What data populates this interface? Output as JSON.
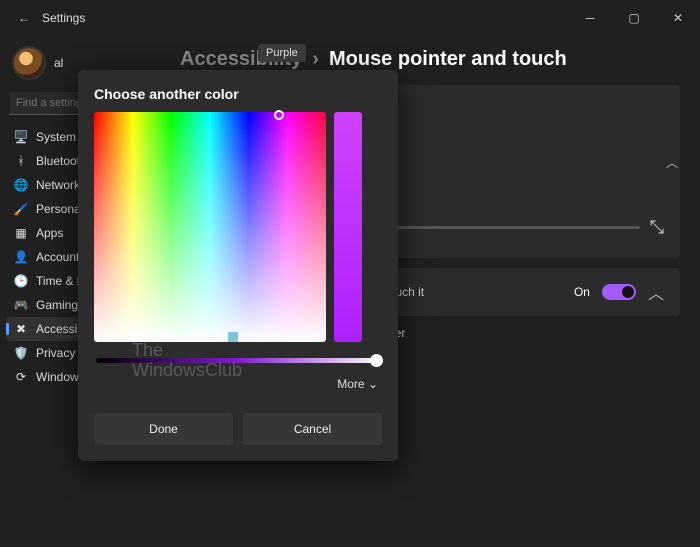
{
  "title": "Settings",
  "account_name": "al",
  "search_placeholder": "Find a setting",
  "sidebar": {
    "items": [
      {
        "icon": "🖥️",
        "label": "System"
      },
      {
        "icon": "ᚼ",
        "label": "Bluetooth & devices"
      },
      {
        "icon": "🌐",
        "label": "Network & internet"
      },
      {
        "icon": "🖌️",
        "label": "Personalization"
      },
      {
        "icon": "▦",
        "label": "Apps"
      },
      {
        "icon": "👤",
        "label": "Accounts"
      },
      {
        "icon": "🕒",
        "label": "Time & language"
      },
      {
        "icon": "🎮",
        "label": "Gaming"
      },
      {
        "icon": "✖",
        "label": "Accessibility",
        "selected": true
      },
      {
        "icon": "🛡️",
        "label": "Privacy & security"
      },
      {
        "icon": "⟳",
        "label": "Windows Update"
      }
    ]
  },
  "breadcrumb": {
    "parent": "Accessibility",
    "sep": "›",
    "current": "Mouse pointer and touch"
  },
  "swatches": [
    "#1fb1c6",
    "#1fb88f"
  ],
  "touch": {
    "desc": "Show a circle on the screen when I touch it",
    "state": "On",
    "checkbox": "Make the circle darker and larger"
  },
  "modal": {
    "title": "Choose another color",
    "tooltip": "Purple",
    "more": "More",
    "done": "Done",
    "cancel": "Cancel"
  },
  "watermark": {
    "l1": "The",
    "l2": "WindowsClub"
  }
}
